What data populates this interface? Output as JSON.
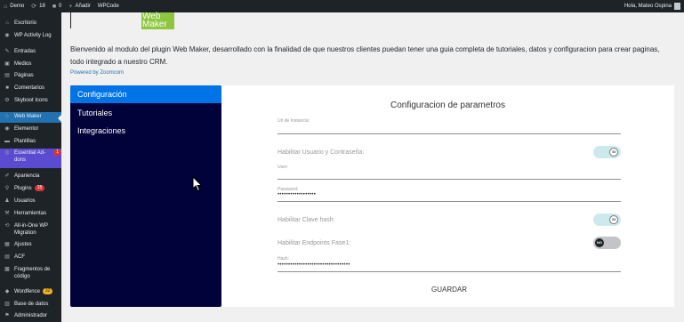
{
  "adminbar": {
    "site_name": "Demo",
    "updates_count": "18",
    "comments_count": "0",
    "add_new": "Añadir",
    "wpcode": "WPCode",
    "greeting": "Hola, Mateo Ospina"
  },
  "sidebar": {
    "items": [
      {
        "icon": "dashboard-icon",
        "label": "Escritorio"
      },
      {
        "icon": "wp-activity-icon",
        "label": "WP Activity Log"
      },
      {
        "icon": "pin-icon",
        "label": "Entradas"
      },
      {
        "icon": "media-icon",
        "label": "Medios"
      },
      {
        "icon": "pages-icon",
        "label": "Páginas"
      },
      {
        "icon": "comments-icon",
        "label": "Comentarios"
      },
      {
        "icon": "gear-icon",
        "label": "Skyboot Icons"
      },
      {
        "icon": "web-maker-icon",
        "label": "Web Maker"
      },
      {
        "icon": "elementor-icon",
        "label": "Elementor"
      },
      {
        "icon": "folder-icon",
        "label": "Plantillas"
      },
      {
        "icon": "essential-addons-icon",
        "label": "Essential Ad-dons",
        "badge": "1"
      },
      {
        "icon": "brush-icon",
        "label": "Apariencia"
      },
      {
        "icon": "plugin-icon",
        "label": "Plugins",
        "badge": "15"
      },
      {
        "icon": "user-icon",
        "label": "Usuarios"
      },
      {
        "icon": "wrench-icon",
        "label": "Herramientas"
      },
      {
        "icon": "migration-icon",
        "label": "All-in-One WP Migration"
      },
      {
        "icon": "settings-icon",
        "label": "Ajustes"
      },
      {
        "icon": "acf-icon",
        "label": "ACF"
      },
      {
        "icon": "snippet-icon",
        "label": "Fragmentos de código"
      },
      {
        "icon": "wordfence-icon",
        "label": "Wordfence",
        "badge": "32"
      },
      {
        "icon": "database-icon",
        "label": "Base de datos"
      },
      {
        "icon": "admin-icon",
        "label": "Administrador"
      }
    ]
  },
  "logo": {
    "line1": "Web",
    "line2": "Maker"
  },
  "intro_text": "Bienvenido al modulo del plugin Web Maker, desarrollado con la finalidad de que nuestros clientes puedan tener una guia completa de tutoriales, datos y configuracion para crear paginas, todo integrado a nuestro CRM.",
  "powered_by": "Powered by Zoomcom",
  "tabs": [
    "Configuración",
    "Tutoriales",
    "Integraciones"
  ],
  "form": {
    "title": "Configuracion de parametros",
    "url_label": "Url de Instancia:",
    "enable_user_label": "Habilitar Usuario y Contraseña:",
    "enable_user_toggle": "SI",
    "user_label": "User:",
    "password_label": "Password:",
    "password_value": "••••••••••••••••••",
    "enable_hash_label": "Habilitar Clave hash:",
    "enable_hash_toggle": "SI",
    "enable_endpoints_label": "Habilitar Endpoints Fase1:",
    "enable_endpoints_toggle": "NO",
    "hash_label": "Hash:",
    "hash_value": "••••••••••••••••••••••••••••••••••",
    "save_label": "GUARDAR"
  },
  "colors": {
    "admin_bg": "#1d2327",
    "accent": "#2271b1",
    "tabs_bg": "#02023a",
    "active_tab": "#0073e6",
    "logo_green": "#8dc63f"
  }
}
